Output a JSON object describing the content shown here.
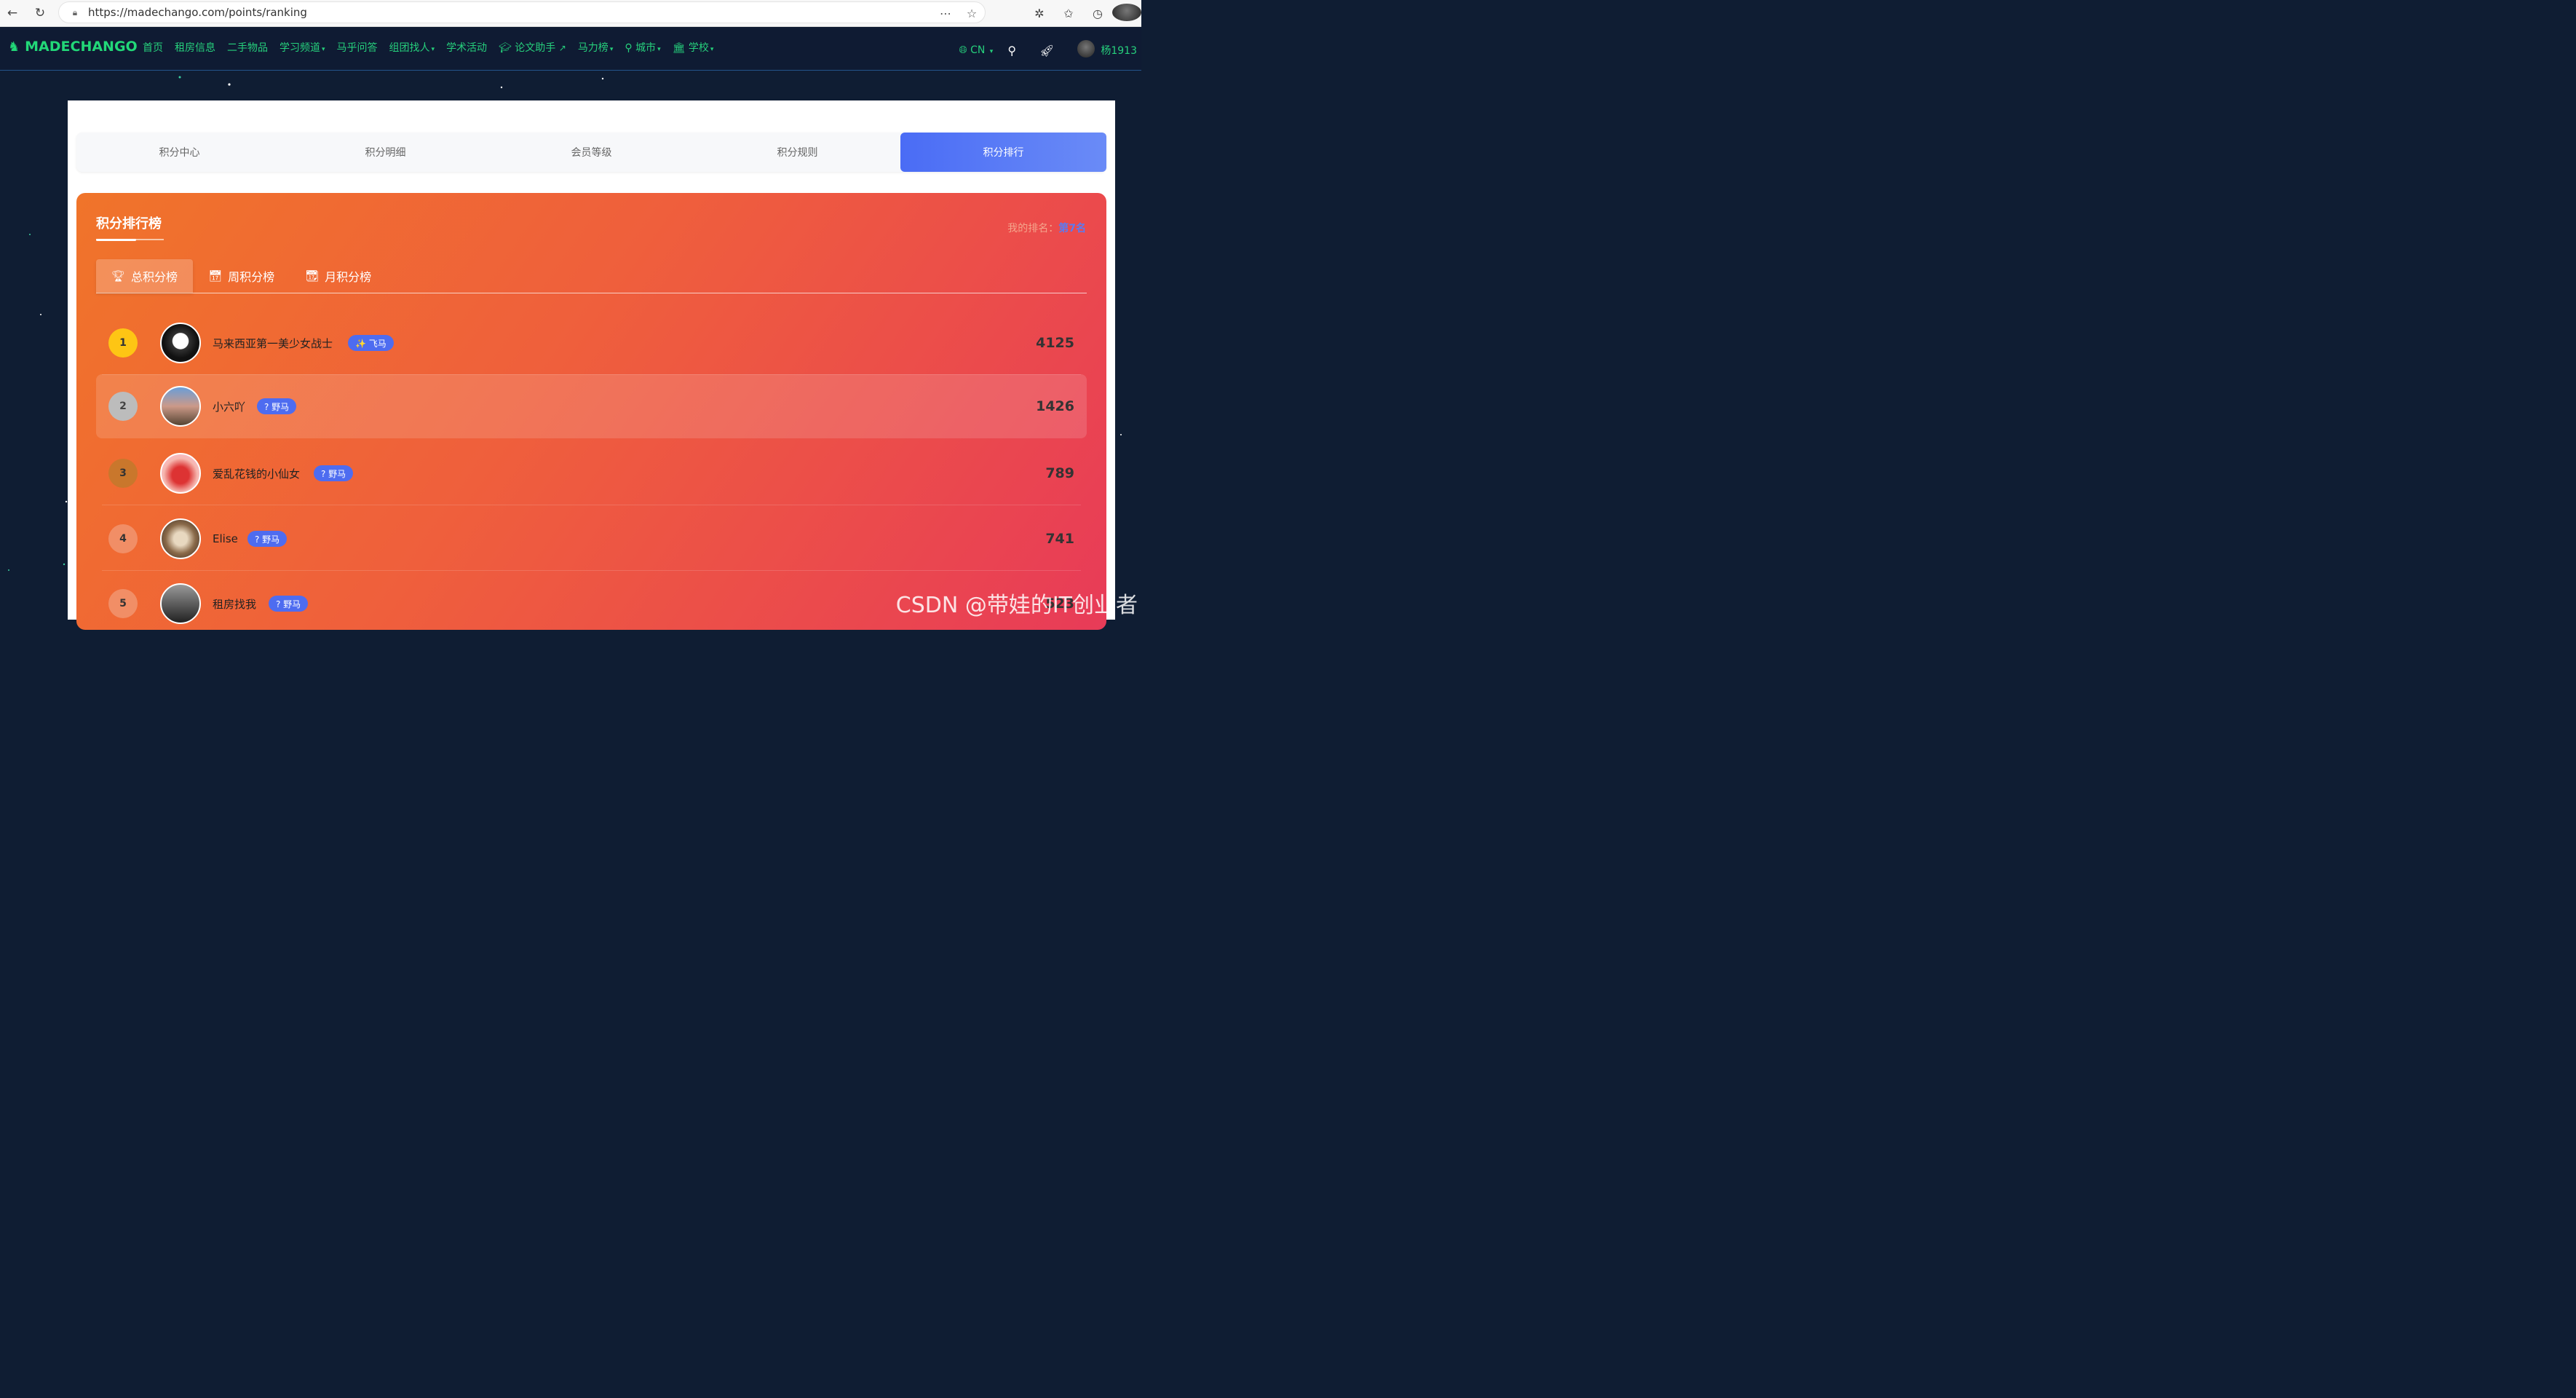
{
  "browser": {
    "url": "https://madechango.com/points/ranking"
  },
  "nav": {
    "logo": "MADECHANGO",
    "items": [
      "首页",
      "租房信息",
      "二手物品",
      "学习频道",
      "马乎问答",
      "组团找人",
      "学术活动",
      "论文助手",
      "马力榜",
      "城市",
      "学校"
    ],
    "lang": "CN",
    "username": "杨1913"
  },
  "tabs": [
    "积分中心",
    "积分明细",
    "会员等级",
    "积分规则",
    "积分排行"
  ],
  "panel": {
    "title": "积分排行榜",
    "my_rank_label": "我的排名：",
    "my_rank_value": "第7名",
    "board_tabs": [
      "总积分榜",
      "周积分榜",
      "月积分榜"
    ]
  },
  "ranking": [
    {
      "rank": "1",
      "name": "马来西亚第一美少女战士",
      "badge": "✨ 飞马",
      "score": "4125"
    },
    {
      "rank": "2",
      "name": "小六吖",
      "badge": "? 野马",
      "score": "1426"
    },
    {
      "rank": "3",
      "name": "爱乱花钱的小仙女",
      "badge": "? 野马",
      "score": "789"
    },
    {
      "rank": "4",
      "name": "Elise",
      "badge": "? 野马",
      "score": "741"
    },
    {
      "rank": "5",
      "name": "租房找我",
      "badge": "? 野马",
      "score": "523"
    }
  ],
  "watermark": "CSDN @带娃的IT创业者"
}
